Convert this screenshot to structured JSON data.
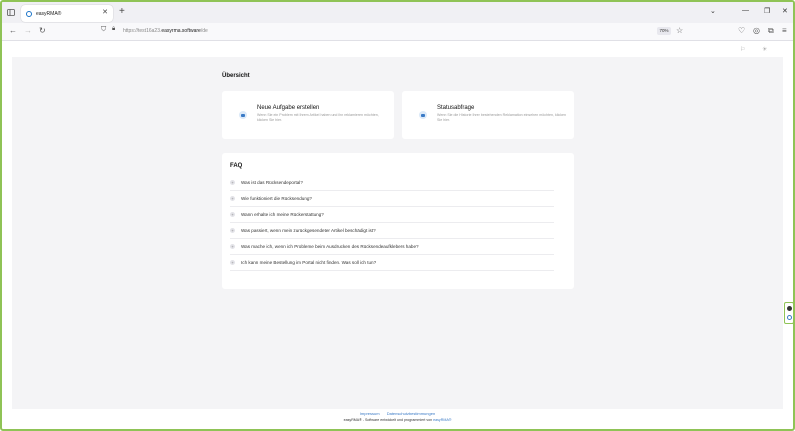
{
  "browser": {
    "tab_title": "easyRMA®",
    "new_tab_symbol": "+",
    "url_prefix": "https://test16a23.",
    "url_host": "easyrma.software",
    "url_path": "/de",
    "zoom": "70%",
    "icons": [
      "sidebar-icon",
      "close-icon",
      "back-icon",
      "forward-icon",
      "reload-icon",
      "shield-icon",
      "lock-icon",
      "star-icon",
      "pocket-icon",
      "account-icon",
      "extensions-icon",
      "menu-icon"
    ]
  },
  "page": {
    "overview_title": "Übersicht",
    "cards": [
      {
        "title": "Neue Aufgabe erstellen",
        "description": "Wenn Sie ein Problem mit Ihrem Artikel haben und ihn reklamieren möchten, klicken Sie hier."
      },
      {
        "title": "Statusabfrage",
        "description": "Wenn Sie die Historie Ihrer bestehenden Reklamation einsehen möchten, klicken Sie hier."
      }
    ],
    "faq": {
      "title": "FAQ",
      "items": [
        "Was ist das Rücksendeportal?",
        "Wie funktioniert die Rücksendung?",
        "Wann erhalte ich meine Rückerstattung?",
        "Was passiert, wenn mein zurückgesendeter Artikel beschädigt ist?",
        "Was mache ich, wenn ich Probleme beim Ausdrucken des Rücksendeaufklebers habe?",
        "Ich kann meine Bestellung im Portal nicht finden. Was soll ich tun?"
      ]
    },
    "footer": {
      "link_impressum": "Impressum",
      "link_privacy": "Datenschutzbestimmungen",
      "text": "easyRMA® - Software entwickelt und programmiert von",
      "brand": "easyRMA®"
    }
  },
  "colors": {
    "accent": "#3a7ac6",
    "frame": "#8fc356",
    "page_background": "#f4f4f6"
  }
}
